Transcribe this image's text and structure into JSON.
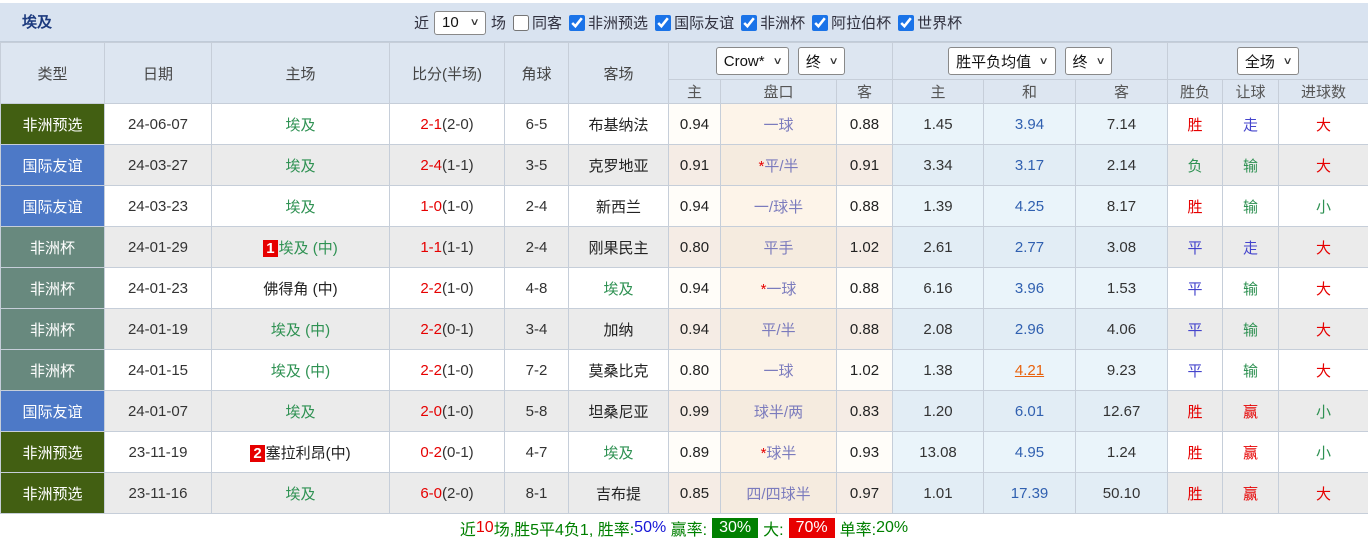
{
  "title": "埃及",
  "controls": {
    "recent_label": "近",
    "recent_value": "10",
    "matches_label": "场",
    "same_away": {
      "label": "同客",
      "checked": false
    },
    "leagues": [
      {
        "label": "非洲预选",
        "checked": true
      },
      {
        "label": "国际友谊",
        "checked": true
      },
      {
        "label": "非洲杯",
        "checked": true
      },
      {
        "label": "阿拉伯杯",
        "checked": true
      },
      {
        "label": "世界杯",
        "checked": true
      }
    ]
  },
  "header": {
    "type": "类型",
    "date": "日期",
    "home": "主场",
    "score": "比分(半场)",
    "corner": "角球",
    "away": "客场",
    "bookmaker": "Crow*",
    "odds_time": "终",
    "avg_label": "胜平负均值",
    "avg_time": "终",
    "period": "全场",
    "sub": {
      "home": "主",
      "handicap": "盘口",
      "away": "客",
      "avg_home": "主",
      "avg_draw": "和",
      "avg_away": "客",
      "wdl": "胜负",
      "handicap_result": "让球",
      "goals": "进球数"
    }
  },
  "rows": [
    {
      "type": "非洲预选",
      "type_key": "afq",
      "date": "24-06-07",
      "home_badge": "",
      "home": "埃及",
      "home_green": true,
      "ft": "2-1",
      "ht": "(2-0)",
      "corner": "6-5",
      "away": "布基纳法",
      "away_green": false,
      "crow_home": "0.94",
      "hc_star": "",
      "handicap": "一球",
      "crow_away": "0.88",
      "avg_home": "1.45",
      "avg_draw": "3.94",
      "draw_hl": false,
      "avg_away": "7.14",
      "wdl": "胜",
      "wdl_k": "red",
      "let": "走",
      "let_k": "blue",
      "goals": "大",
      "goals_k": "red"
    },
    {
      "type": "国际友谊",
      "type_key": "friendly",
      "date": "24-03-27",
      "home_badge": "",
      "home": "埃及",
      "home_green": true,
      "ft": "2-4",
      "ht": "(1-1)",
      "corner": "3-5",
      "away": "克罗地亚",
      "away_green": false,
      "crow_home": "0.91",
      "hc_star": "*",
      "handicap": "平/半",
      "crow_away": "0.91",
      "avg_home": "3.34",
      "avg_draw": "3.17",
      "draw_hl": false,
      "avg_away": "2.14",
      "wdl": "负",
      "wdl_k": "green",
      "let": "输",
      "let_k": "green",
      "goals": "大",
      "goals_k": "red"
    },
    {
      "type": "国际友谊",
      "type_key": "friendly",
      "date": "24-03-23",
      "home_badge": "",
      "home": "埃及",
      "home_green": true,
      "ft": "1-0",
      "ht": "(1-0)",
      "corner": "2-4",
      "away": "新西兰",
      "away_green": false,
      "crow_home": "0.94",
      "hc_star": "",
      "handicap": "一/球半",
      "crow_away": "0.88",
      "avg_home": "1.39",
      "avg_draw": "4.25",
      "draw_hl": false,
      "avg_away": "8.17",
      "wdl": "胜",
      "wdl_k": "red",
      "let": "输",
      "let_k": "green",
      "goals": "小",
      "goals_k": "green"
    },
    {
      "type": "非洲杯",
      "type_key": "afcup",
      "date": "24-01-29",
      "home_badge": "1",
      "home": "埃及 (中)",
      "home_green": true,
      "ft": "1-1",
      "ht": "(1-1)",
      "corner": "2-4",
      "away": "刚果民主",
      "away_green": false,
      "crow_home": "0.80",
      "hc_star": "",
      "handicap": "平手",
      "crow_away": "1.02",
      "avg_home": "2.61",
      "avg_draw": "2.77",
      "draw_hl": false,
      "avg_away": "3.08",
      "wdl": "平",
      "wdl_k": "blue",
      "let": "走",
      "let_k": "blue",
      "goals": "大",
      "goals_k": "red"
    },
    {
      "type": "非洲杯",
      "type_key": "afcup",
      "date": "24-01-23",
      "home_badge": "",
      "home": "佛得角 (中)",
      "home_green": false,
      "ft": "2-2",
      "ht": "(1-0)",
      "corner": "4-8",
      "away": "埃及",
      "away_green": true,
      "crow_home": "0.94",
      "hc_star": "*",
      "handicap": "一球",
      "crow_away": "0.88",
      "avg_home": "6.16",
      "avg_draw": "3.96",
      "draw_hl": false,
      "avg_away": "1.53",
      "wdl": "平",
      "wdl_k": "blue",
      "let": "输",
      "let_k": "green",
      "goals": "大",
      "goals_k": "red"
    },
    {
      "type": "非洲杯",
      "type_key": "afcup",
      "date": "24-01-19",
      "home_badge": "",
      "home": "埃及 (中)",
      "home_green": true,
      "ft": "2-2",
      "ht": "(0-1)",
      "corner": "3-4",
      "away": "加纳",
      "away_green": false,
      "crow_home": "0.94",
      "hc_star": "",
      "handicap": "平/半",
      "crow_away": "0.88",
      "avg_home": "2.08",
      "avg_draw": "2.96",
      "draw_hl": false,
      "avg_away": "4.06",
      "wdl": "平",
      "wdl_k": "blue",
      "let": "输",
      "let_k": "green",
      "goals": "大",
      "goals_k": "red"
    },
    {
      "type": "非洲杯",
      "type_key": "afcup",
      "date": "24-01-15",
      "home_badge": "",
      "home": "埃及 (中)",
      "home_green": true,
      "ft": "2-2",
      "ht": "(1-0)",
      "corner": "7-2",
      "away": "莫桑比克",
      "away_green": false,
      "crow_home": "0.80",
      "hc_star": "",
      "handicap": "一球",
      "crow_away": "1.02",
      "avg_home": "1.38",
      "avg_draw": "4.21",
      "draw_hl": true,
      "avg_away": "9.23",
      "wdl": "平",
      "wdl_k": "blue",
      "let": "输",
      "let_k": "green",
      "goals": "大",
      "goals_k": "red"
    },
    {
      "type": "国际友谊",
      "type_key": "friendly",
      "date": "24-01-07",
      "home_badge": "",
      "home": "埃及",
      "home_green": true,
      "ft": "2-0",
      "ht": "(1-0)",
      "corner": "5-8",
      "away": "坦桑尼亚",
      "away_green": false,
      "crow_home": "0.99",
      "hc_star": "",
      "handicap": "球半/两",
      "crow_away": "0.83",
      "avg_home": "1.20",
      "avg_draw": "6.01",
      "draw_hl": false,
      "avg_away": "12.67",
      "wdl": "胜",
      "wdl_k": "red",
      "let": "赢",
      "let_k": "red",
      "goals": "小",
      "goals_k": "green"
    },
    {
      "type": "非洲预选",
      "type_key": "afq",
      "date": "23-11-19",
      "home_badge": "2",
      "home": "塞拉利昂(中)",
      "home_green": false,
      "ft": "0-2",
      "ht": "(0-1)",
      "corner": "4-7",
      "away": "埃及",
      "away_green": true,
      "crow_home": "0.89",
      "hc_star": "*",
      "handicap": "球半",
      "crow_away": "0.93",
      "avg_home": "13.08",
      "avg_draw": "4.95",
      "draw_hl": false,
      "avg_away": "1.24",
      "wdl": "胜",
      "wdl_k": "red",
      "let": "赢",
      "let_k": "red",
      "goals": "小",
      "goals_k": "green"
    },
    {
      "type": "非洲预选",
      "type_key": "afq",
      "date": "23-11-16",
      "home_badge": "",
      "home": "埃及",
      "home_green": true,
      "ft": "6-0",
      "ht": "(2-0)",
      "corner": "8-1",
      "away": "吉布提",
      "away_green": false,
      "crow_home": "0.85",
      "hc_star": "",
      "handicap": "四/四球半",
      "crow_away": "0.97",
      "avg_home": "1.01",
      "avg_draw": "17.39",
      "draw_hl": false,
      "avg_away": "50.10",
      "wdl": "胜",
      "wdl_k": "red",
      "let": "赢",
      "let_k": "red",
      "goals": "大",
      "goals_k": "red"
    }
  ],
  "footer": {
    "prefix": "近",
    "count": "10",
    "mid": "场,胜5平4负1, 胜率:",
    "win_rate": "50%",
    "win_label": " 赢率:",
    "win_badge": "30%",
    "big_label": "大:",
    "big_badge": "70%",
    "single_label": "单率:",
    "single_value": "20%"
  },
  "colors": {
    "bar_bg": "#d9e3f0",
    "header_bg": "#dde6f1",
    "stripe": "#ebebeb",
    "type_afq": "#425f12",
    "type_friendly": "#4d79c7",
    "type_afcup": "#68897e",
    "team_green": "#2e9152",
    "score_red": "#e60000",
    "result_blue": "#4444cc",
    "avg_blue": "#3060b0",
    "highlight_orange": "#e8620d",
    "handicap_purple": "#7b7bbd",
    "footer_green": "#008000",
    "footer_blue": "#1616d6"
  }
}
